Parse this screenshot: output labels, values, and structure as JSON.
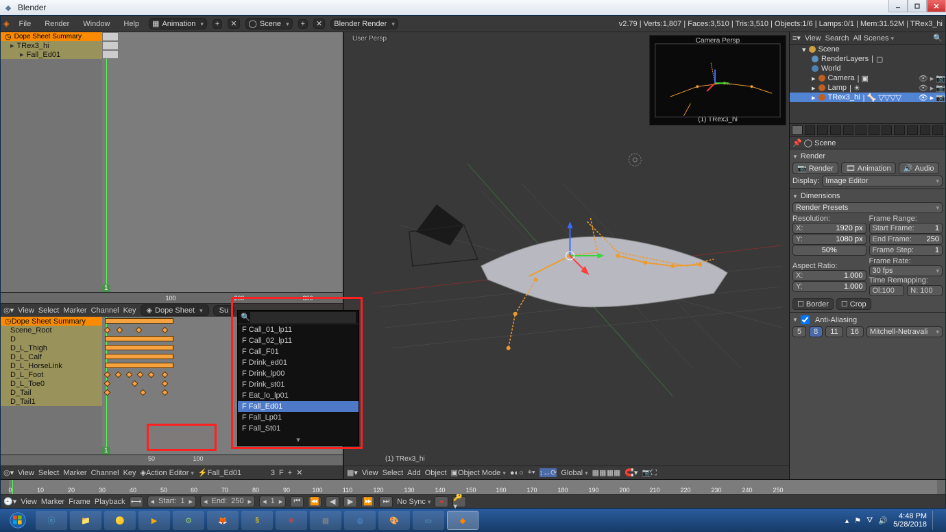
{
  "window": {
    "title": "Blender"
  },
  "topmenu": {
    "items": [
      "File",
      "Render",
      "Window",
      "Help"
    ],
    "layout": "Animation",
    "scene": "Scene",
    "engine": "Blender Render",
    "stats": "v2.79 | Verts:1,807 | Faces:3,510 | Tris:3,510 | Objects:1/6 | Lamps:0/1 | Mem:31.52M | TRex3_hi"
  },
  "dopesheet_top": {
    "summary": "Dope Sheet Summary",
    "row1": "TRex3_hi",
    "row2": "Fall_Ed01",
    "ruler": {
      "100": 100,
      "200": 200,
      "300": 300
    },
    "menu": [
      "View",
      "Select",
      "Marker",
      "Channel",
      "Key"
    ],
    "mode": "Dope Sheet",
    "search_btn": "Su"
  },
  "action_editor": {
    "summary": "Dope Sheet Summary",
    "bones": [
      "Scene_Root",
      "D",
      "D_L_Thigh",
      "D_L_Calf",
      "D_L_HorseLink",
      "D_L_Foot",
      "D_L_Toe0",
      "D_Tail",
      "D_Tail1"
    ],
    "ruler": {
      "50": 50,
      "100": 100
    },
    "menu": [
      "View",
      "Select",
      "Marker",
      "Channel",
      "Key"
    ],
    "mode": "Action Editor",
    "action_name": "Fall_Ed01",
    "users": "3",
    "fake": "F"
  },
  "popup": {
    "options": [
      "F Call_01_lp11",
      "F Call_02_lp11",
      "F Call_F01",
      "F Drink_ed01",
      "F Drink_lp00",
      "F Drink_st01",
      "F Eat_lo_lp01",
      "F Fall_Ed01",
      "F Fall_Lp01",
      "F Fall_St01"
    ],
    "selected_index": 7
  },
  "viewport": {
    "label": "User Persp",
    "object": "(1) TRex3_hi",
    "mini_label": "Camera Persp",
    "mini_object": "(1) TRex3_hi",
    "menu": [
      "View",
      "Select",
      "Add",
      "Object"
    ],
    "mode": "Object Mode",
    "orient": "Global"
  },
  "outliner": {
    "menu": [
      "View",
      "Search"
    ],
    "filter": "All Scenes",
    "nodes": [
      "Scene",
      "RenderLayers",
      "World",
      "Camera",
      "Lamp",
      "TRex3_hi"
    ]
  },
  "props": {
    "context": "Scene",
    "render_head": "Render",
    "render_btn": "Render",
    "anim_btn": "Animation",
    "audio_btn": "Audio",
    "display_lbl": "Display:",
    "display_val": "Image Editor",
    "dim_head": "Dimensions",
    "presets": "Render Presets",
    "res_lbl": "Resolution:",
    "res_x": {
      "k": "X:",
      "v": "1920 px"
    },
    "res_y": {
      "k": "Y:",
      "v": "1080 px"
    },
    "res_pct": "50%",
    "frange_lbl": "Frame Range:",
    "frange_s": {
      "k": "Start Frame:",
      "v": "1"
    },
    "frange_e": {
      "k": "End Frame:",
      "v": "250"
    },
    "frange_step": {
      "k": "Frame Step:",
      "v": "1"
    },
    "aspect_lbl": "Aspect Ratio:",
    "aspect_x": {
      "k": "X:",
      "v": "1.000"
    },
    "aspect_y": {
      "k": "Y:",
      "v": "1.000"
    },
    "frate_lbl": "Frame Rate:",
    "frate_val": "30 fps",
    "tremap": "Time Remapping:",
    "tremap_old": {
      "k": "Ol:100",
      "v": ""
    },
    "tremap_new": {
      "k": "N: 100",
      "v": ""
    },
    "border_lbl": "Border",
    "crop_lbl": "Crop",
    "aa_head": "Anti-Aliasing",
    "aa_opts": [
      "5",
      "8",
      "11",
      "16"
    ],
    "aa_filter": "Mitchell-Netravali"
  },
  "timeline": {
    "menu": [
      "View",
      "Marker",
      "Frame",
      "Playback"
    ],
    "start": {
      "k": "Start:",
      "v": "1"
    },
    "end": {
      "k": "End:",
      "v": "250"
    },
    "cur": "1",
    "sync": "No Sync",
    "ticks": [
      "0",
      "10",
      "20",
      "30",
      "40",
      "50",
      "60",
      "70",
      "80",
      "90",
      "100",
      "110",
      "120",
      "130",
      "140",
      "150",
      "160",
      "170",
      "180",
      "190",
      "200",
      "210",
      "220",
      "230",
      "240",
      "250"
    ]
  },
  "taskbar": {
    "time": "4:48 PM",
    "date": "5/28/2018"
  }
}
